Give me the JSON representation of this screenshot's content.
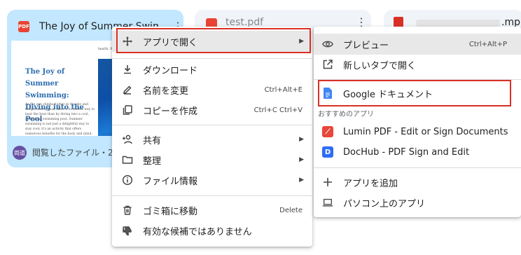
{
  "card1": {
    "badge": "PDF",
    "title": "The Joy of Summer Swimming",
    "thumb_title": "The Joy of Summer Swimming: Diving into the Pool",
    "thumb_body": "As the sun climbs higher in the sky and temperatures soar, there's no better way to beat the heat than by diving into a cool, refreshing swimming pool. Summer swimming is not just a delightful way to stay cool; it's an activity that offers numerous benefits for the body and mind. From",
    "thumb_img_caption": "health. Regular swimming...",
    "avatar": "両道",
    "footer": "閲覧したファイル・202"
  },
  "card2": {
    "title": "test.pdf"
  },
  "card3": {
    "title": ".mp"
  },
  "context_menu": {
    "items": [
      {
        "label": "アプリで開く",
        "icon": "move-icon"
      },
      {
        "label": "ダウンロード",
        "icon": "download-icon"
      },
      {
        "label": "名前を変更",
        "icon": "pencil-icon",
        "shortcut": "Ctrl+Alt+E"
      },
      {
        "label": "コピーを作成",
        "icon": "copy-icon",
        "shortcut": "Ctrl+C Ctrl+V"
      },
      {
        "label": "共有",
        "icon": "person-add-icon"
      },
      {
        "label": "整理",
        "icon": "folder-icon"
      },
      {
        "label": "ファイル情報",
        "icon": "info-icon"
      },
      {
        "label": "ゴミ箱に移動",
        "icon": "trash-icon",
        "shortcut": "Delete"
      },
      {
        "label": "有効な候補ではありません",
        "icon": "thumb-down-icon"
      }
    ]
  },
  "submenu": {
    "preview": {
      "label": "プレビュー",
      "shortcut": "Ctrl+Alt+P"
    },
    "new_tab": {
      "label": "新しいタブで開く"
    },
    "google_docs": {
      "label": "Google ドキュメント"
    },
    "section_label": "おすすめのアプリ",
    "lumin": {
      "label": "Lumin PDF - Edit or Sign Documents",
      "badge": "⟋",
      "color": "#e8463a"
    },
    "dochub": {
      "label": "DocHub - PDF Sign and Edit",
      "badge": "D",
      "color": "#2d6df6"
    },
    "add_app": {
      "label": "アプリを追加"
    },
    "pc_app": {
      "label": "パソコン上のアプリ"
    }
  },
  "colors": {
    "highlight_outline": "#d93025",
    "card_selected": "#c2e7ff",
    "hover": "#e8e8e8"
  }
}
